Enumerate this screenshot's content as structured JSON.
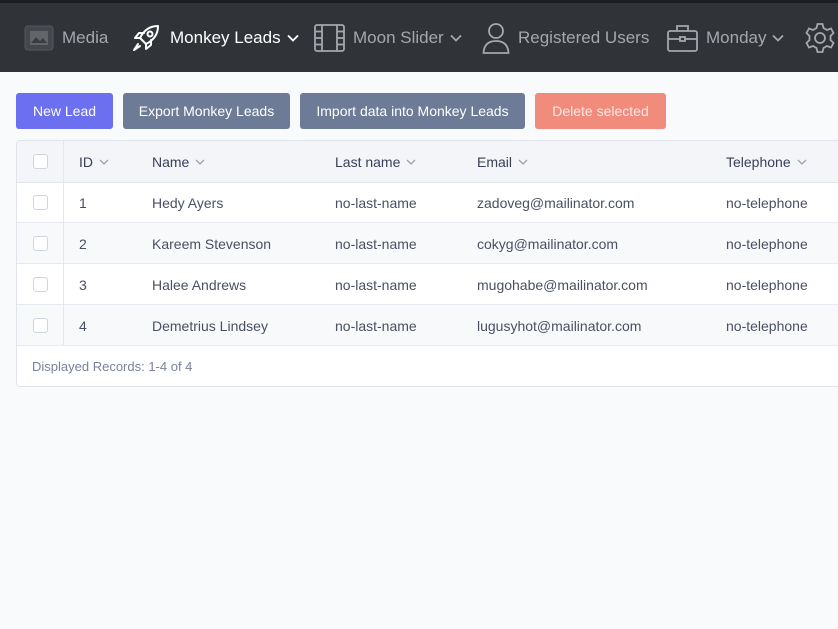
{
  "nav": {
    "items": [
      {
        "label": "Media",
        "icon": "media-icon",
        "has_dropdown": false
      },
      {
        "label": "Monkey Leads",
        "icon": "rocket-icon",
        "has_dropdown": true,
        "active": true
      },
      {
        "label": "Moon Slider",
        "icon": "film-icon",
        "has_dropdown": true
      },
      {
        "label": "Registered Users",
        "icon": "user-icon",
        "has_dropdown": false
      },
      {
        "label": "Monday",
        "icon": "briefcase-icon",
        "has_dropdown": true
      },
      {
        "label": "",
        "icon": "gear-icon",
        "has_dropdown": false
      }
    ]
  },
  "toolbar": {
    "new_lead": "New Lead",
    "export": "Export Monkey Leads",
    "import": "Import data into Monkey Leads",
    "delete": "Delete selected"
  },
  "table": {
    "headers": [
      "ID",
      "Name",
      "Last name",
      "Email",
      "Telephone"
    ],
    "rows": [
      {
        "id": "1",
        "name": "Hedy Ayers",
        "last_name": "no-last-name",
        "email": "zadoveg@mailinator.com",
        "telephone": "no-telephone"
      },
      {
        "id": "2",
        "name": "Kareem Stevenson",
        "last_name": "no-last-name",
        "email": "cokyg@mailinator.com",
        "telephone": "no-telephone"
      },
      {
        "id": "3",
        "name": "Halee Andrews",
        "last_name": "no-last-name",
        "email": "mugohabe@mailinator.com",
        "telephone": "no-telephone"
      },
      {
        "id": "4",
        "name": "Demetrius Lindsey",
        "last_name": "no-last-name",
        "email": "lugusyhot@mailinator.com",
        "telephone": "no-telephone"
      }
    ],
    "footer": "Displayed Records: 1-4 of 4"
  },
  "colors": {
    "topbar": "#303438",
    "primary": "#6b6ff0",
    "secondary": "#6e7b96",
    "danger": "#f18b7c"
  }
}
